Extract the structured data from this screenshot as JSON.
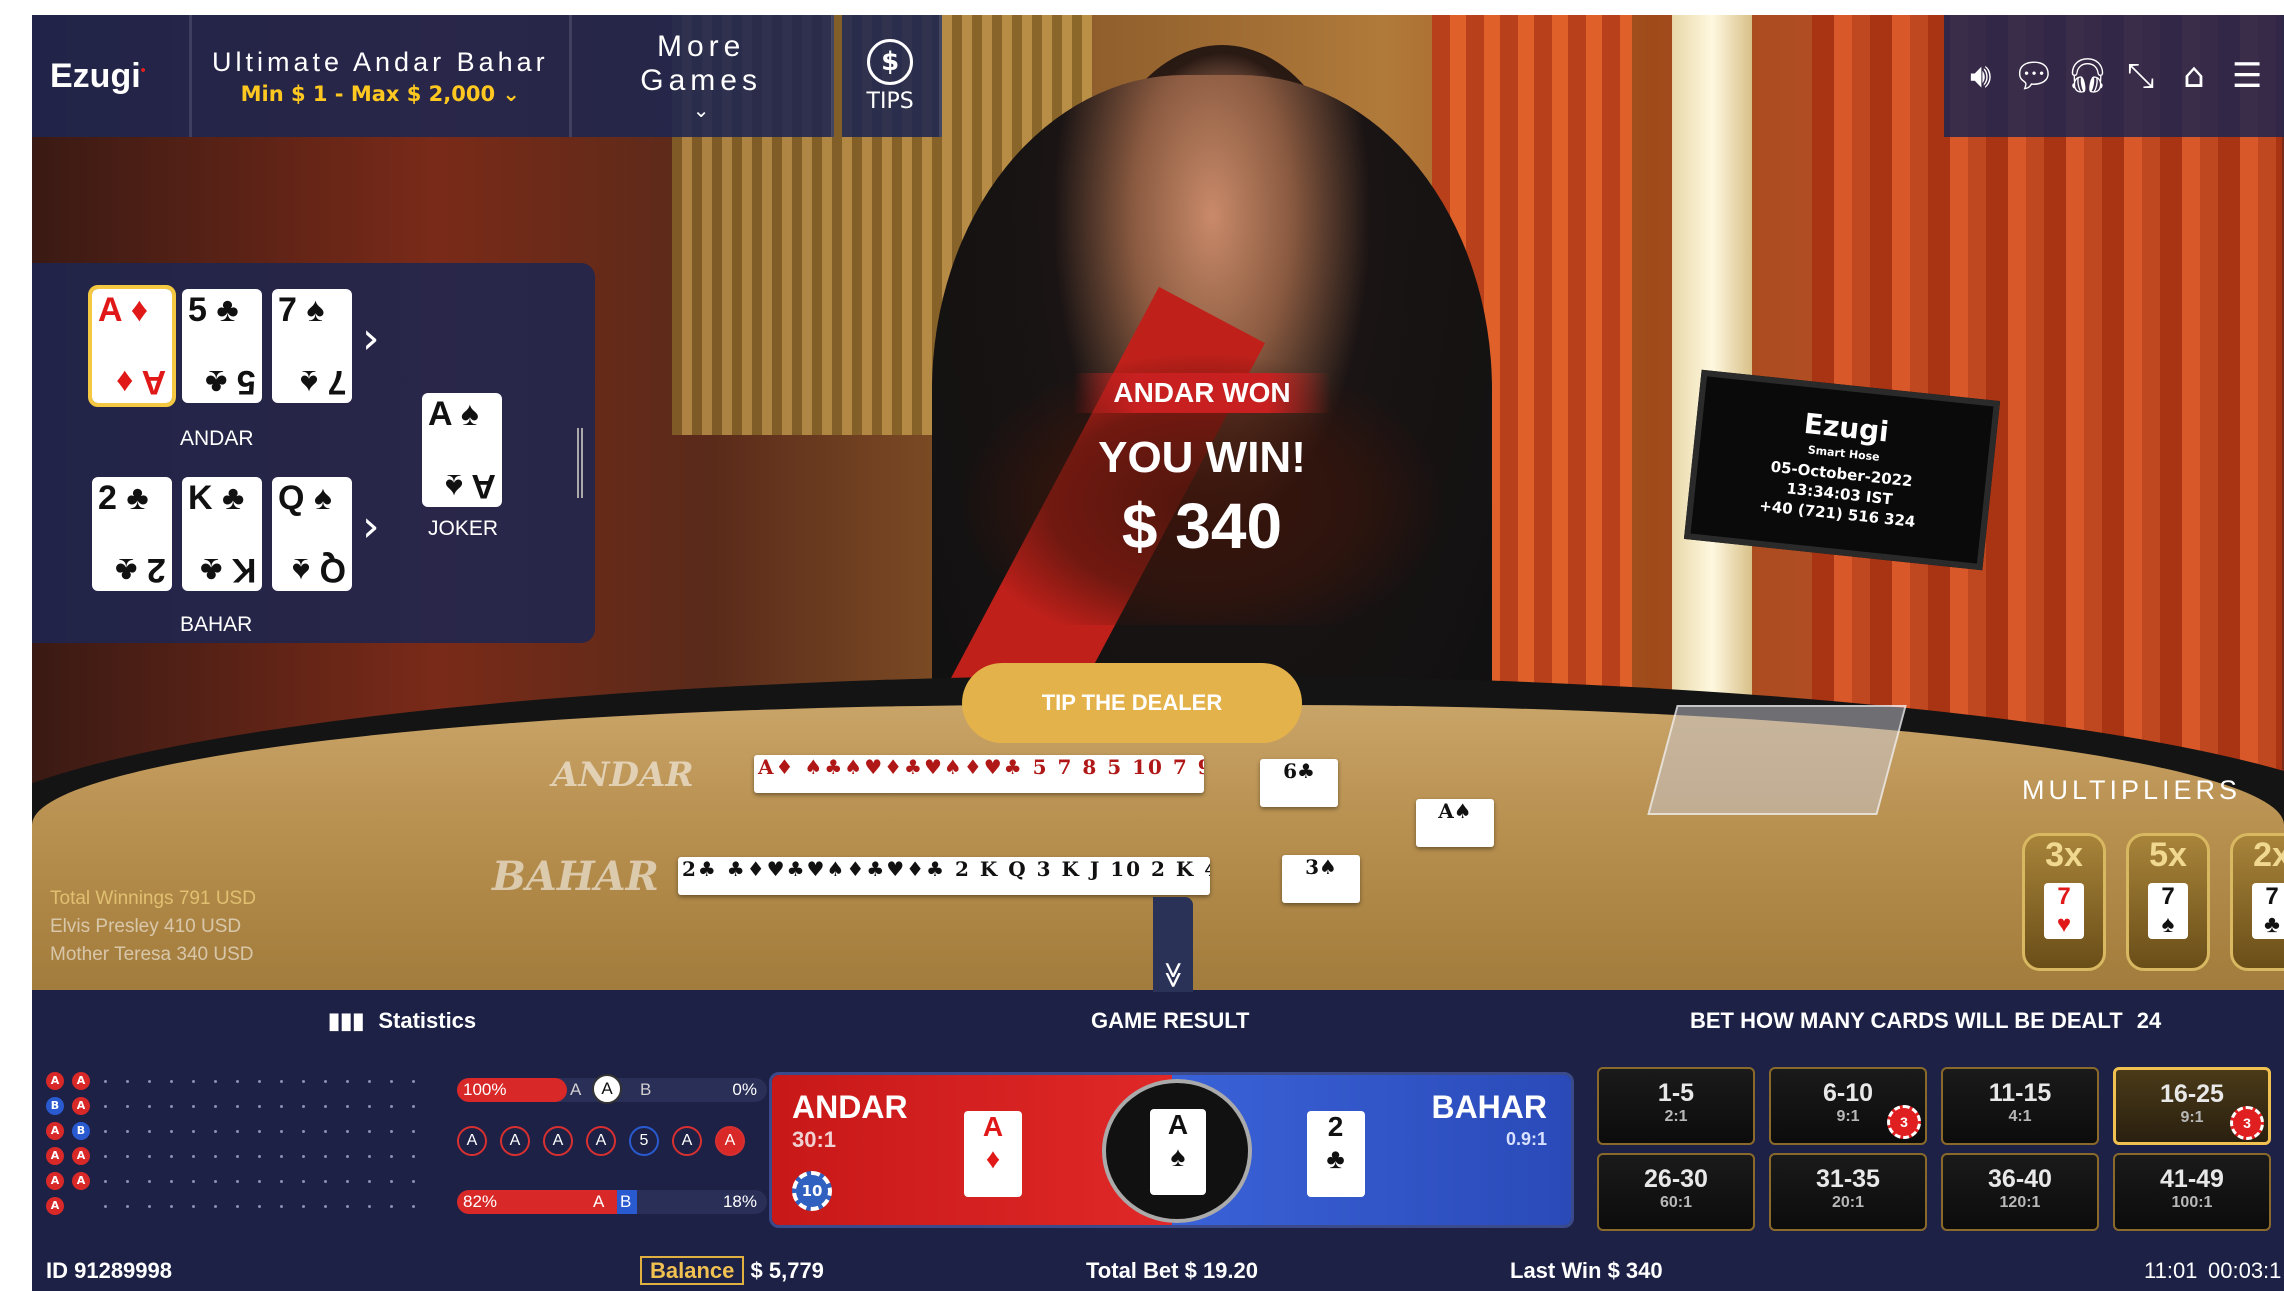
{
  "brand": {
    "name": "Ezugi",
    "dot": "•"
  },
  "table": {
    "name": "Ultimate Andar Bahar",
    "limits": "Min $ 1 - Max $ 2,000",
    "limits_chevron": "⌄"
  },
  "more_games": {
    "label": "More Games",
    "chevron": "⌄"
  },
  "tips": {
    "label": "TIPS",
    "symbol": "$"
  },
  "toolbar_icons": [
    "speaker-icon",
    "chat-icon",
    "headset-icon",
    "minimize-icon",
    "home-icon",
    "menu-icon"
  ],
  "cards_panel": {
    "andar_label": "ANDAR",
    "bahar_label": "BAHAR",
    "joker_label": "JOKER",
    "andar_cards": [
      {
        "rank": "A",
        "suit": "♦",
        "color": "red",
        "highlight": true
      },
      {
        "rank": "5",
        "suit": "♣",
        "color": "black"
      },
      {
        "rank": "7",
        "suit": "♠",
        "color": "black"
      }
    ],
    "bahar_cards": [
      {
        "rank": "2",
        "suit": "♣",
        "color": "black"
      },
      {
        "rank": "K",
        "suit": "♣",
        "color": "black"
      },
      {
        "rank": "Q",
        "suit": "♠",
        "color": "black"
      }
    ],
    "joker_card": {
      "rank": "A",
      "suit": "♠",
      "color": "black"
    }
  },
  "monitor": {
    "brand": "Ezugi",
    "sub": "Smart Hose",
    "date": "05-October-2022",
    "time": "13:34:03 IST",
    "phone": "+40 (721) 516 324"
  },
  "felt": {
    "andar": "ANDAR",
    "bahar": "BAHAR"
  },
  "win": {
    "label": "ANDAR WON",
    "message": "YOU WIN!",
    "amount": "$ 340"
  },
  "tip_button": "TIP THE DEALER",
  "multipliers": {
    "title": "MULTIPLIERS",
    "items": [
      {
        "value": "3x",
        "card": "7",
        "suit": "♥",
        "color": "red"
      },
      {
        "value": "5x",
        "card": "7",
        "suit": "♠",
        "color": "black"
      },
      {
        "value": "2x",
        "card": "7",
        "suit": "♣",
        "color": "black"
      }
    ]
  },
  "winners": [
    {
      "text": "Total Winnings  791 USD"
    },
    {
      "text": "Elvis Presley  410 USD"
    },
    {
      "text": "Mother Teresa  340 USD"
    }
  ],
  "collapse_glyph": "≫",
  "statistics": {
    "label": "Statistics",
    "bead_road": [
      "A",
      "A",
      "B",
      "A",
      "A",
      "B",
      "A",
      "A",
      "A",
      "A",
      "A"
    ],
    "bar1": {
      "left": "100%",
      "a": "A",
      "b": "B",
      "right": "0%"
    },
    "bar2": {
      "left": "82%",
      "a": "A",
      "b": "B",
      "right": "18%"
    },
    "big_road": [
      "A",
      "A",
      "A",
      "A",
      "5",
      "A",
      "A"
    ]
  },
  "game_result": {
    "label": "GAME RESULT",
    "andar": {
      "name": "ANDAR",
      "odds": "30:1",
      "card_rank": "A",
      "card_suit": "♦",
      "chip": "10"
    },
    "joker": {
      "rank": "A",
      "suit": "♠"
    },
    "bahar": {
      "name": "BAHAR",
      "odds": "0.9:1",
      "card_rank": "2",
      "card_suit": "♣"
    }
  },
  "side_bet": {
    "label": "BET HOW MANY CARDS WILL BE DEALT",
    "count": "24",
    "options": [
      {
        "range": "1-5",
        "odds": "2:1"
      },
      {
        "range": "6-10",
        "odds": "9:1",
        "chip": "3"
      },
      {
        "range": "11-15",
        "odds": "4:1"
      },
      {
        "range": "16-25",
        "odds": "9:1",
        "chip": "3",
        "selected": true
      },
      {
        "range": "26-30",
        "odds": "60:1"
      },
      {
        "range": "31-35",
        "odds": "20:1"
      },
      {
        "range": "36-40",
        "odds": "120:1"
      },
      {
        "range": "41-49",
        "odds": "100:1"
      }
    ]
  },
  "footer": {
    "id": "ID 91289998",
    "balance_label": "Balance",
    "balance": "$ 5,779",
    "total_bet": "Total Bet $ 19.20",
    "last_win": "Last Win $ 340",
    "time": "11:01",
    "elapsed": "00:03:1"
  }
}
